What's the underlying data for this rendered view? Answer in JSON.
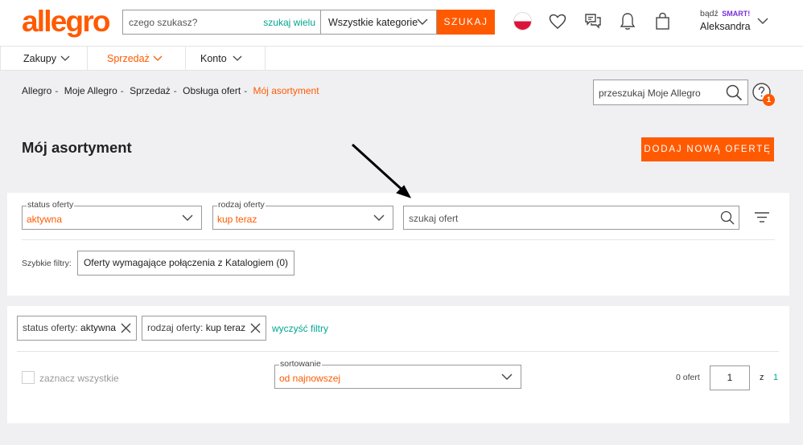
{
  "header": {
    "logo": "allegro",
    "search_placeholder": "czego szukasz?",
    "search_many": "szukaj wielu",
    "category": "Wszystkie kategorie",
    "search_button": "SZUKAJ",
    "become": "bądź",
    "smart": "SMART!",
    "user_name": "Aleksandra"
  },
  "nav": {
    "items": [
      {
        "label": "Zakupy"
      },
      {
        "label": "Sprzedaż"
      },
      {
        "label": "Konto"
      }
    ]
  },
  "breadcrumb": {
    "items": [
      "Allegro",
      "Moje Allegro",
      "Sprzedaż",
      "Obsługa ofert"
    ],
    "current": "Mój asortyment"
  },
  "my_allegro_search": {
    "placeholder": "przeszukaj Moje Allegro"
  },
  "help": {
    "badge": "1"
  },
  "page": {
    "title": "Mój asortyment",
    "add_button": "DODAJ NOWĄ OFERTĘ"
  },
  "filters": {
    "status": {
      "legend": "status oferty",
      "value": "aktywna"
    },
    "type": {
      "legend": "rodzaj oferty",
      "value": "kup teraz"
    },
    "search_placeholder": "szukaj ofert",
    "quick_label": "Szybkie filtry:",
    "quick_button": "Oferty wymagające połączenia z Katalogiem (0)"
  },
  "active_filters": {
    "chips": [
      {
        "key": "status oferty:",
        "value": "aktywna"
      },
      {
        "key": "rodzaj oferty:",
        "value": "kup teraz"
      }
    ],
    "clear": "wyczyść filtry"
  },
  "list": {
    "select_all": "zaznacz wszystkie",
    "sort": {
      "legend": "sortowanie",
      "value": "od najnowszej"
    },
    "count": "0 ofert",
    "page_value": "1",
    "of": "z",
    "total_pages": "1"
  },
  "colors": {
    "brand": "#ff5a00",
    "link": "#00a790",
    "smart": "#7a2edc"
  }
}
